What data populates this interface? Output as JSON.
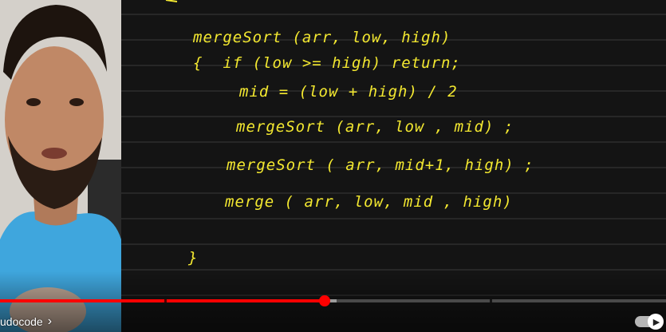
{
  "notes": {
    "lines": [
      "mergeSort (arr, low, high)",
      "{  if (low >= high) return;",
      "mid = (low + high) / 2",
      "mergeSort (arr, low , mid) ;",
      "mergeSort ( arr, mid+1, high) ;",
      "merge ( arr, low, mid , high)",
      "}"
    ],
    "ink_color": "#f3e830",
    "background_color": "#141414"
  },
  "player": {
    "progress_fraction": 0.488,
    "buffer_fraction": 0.505,
    "chapter_title": "udocode",
    "chapter_chevron": "›",
    "autoplay_on": true,
    "autoplay_icon": "play-icon",
    "accent_color": "#ff0000"
  }
}
